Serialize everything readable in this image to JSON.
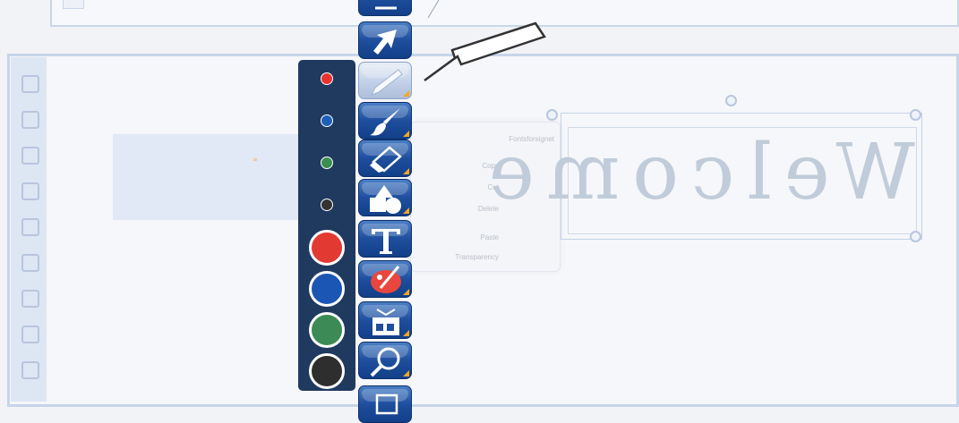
{
  "colors": {
    "toolbar_blue": "#1e4e9e",
    "palette_bg": "#20395f",
    "tool_badge": "#f5a623"
  },
  "background_menu": {
    "items": [
      "Fontsforsignet",
      "Copy",
      "Cut",
      "Delete",
      "Paste",
      "Transparency"
    ]
  },
  "canvas": {
    "text": "Welcome"
  },
  "palette": {
    "swatches": [
      {
        "name": "red-small",
        "size": "small",
        "color": "#e8332e"
      },
      {
        "name": "blue-small",
        "size": "small",
        "color": "#1f5fb8"
      },
      {
        "name": "green-small",
        "size": "small",
        "color": "#3a8f4f"
      },
      {
        "name": "black-small",
        "size": "small",
        "color": "#333333"
      },
      {
        "name": "red-large",
        "size": "large",
        "color": "#e23a33"
      },
      {
        "name": "blue-large",
        "size": "large",
        "color": "#1b56b5"
      },
      {
        "name": "green-large",
        "size": "large",
        "color": "#3c8a55"
      },
      {
        "name": "black-large",
        "size": "large",
        "color": "#2e2e2e"
      }
    ]
  },
  "toolbar": {
    "tools": [
      {
        "icon": "collapse-icon",
        "name": "tool-top",
        "active": false
      },
      {
        "icon": "select-arrow-icon",
        "name": "tool-select",
        "active": false
      },
      {
        "icon": "pen-icon",
        "name": "tool-pen",
        "active": true
      },
      {
        "icon": "brush-icon",
        "name": "tool-brush",
        "active": false
      },
      {
        "icon": "eraser-icon",
        "name": "tool-eraser",
        "active": false
      },
      {
        "icon": "shapes-icon",
        "name": "tool-shapes",
        "active": false
      },
      {
        "icon": "text-icon",
        "name": "tool-text",
        "active": false
      },
      {
        "icon": "paint-palette-icon",
        "name": "tool-fill",
        "active": false
      },
      {
        "icon": "gallery-icon",
        "name": "tool-gallery",
        "active": false
      },
      {
        "icon": "magnifier-icon",
        "name": "tool-zoom",
        "active": false
      },
      {
        "icon": "more-icon",
        "name": "tool-more",
        "active": false
      }
    ]
  }
}
